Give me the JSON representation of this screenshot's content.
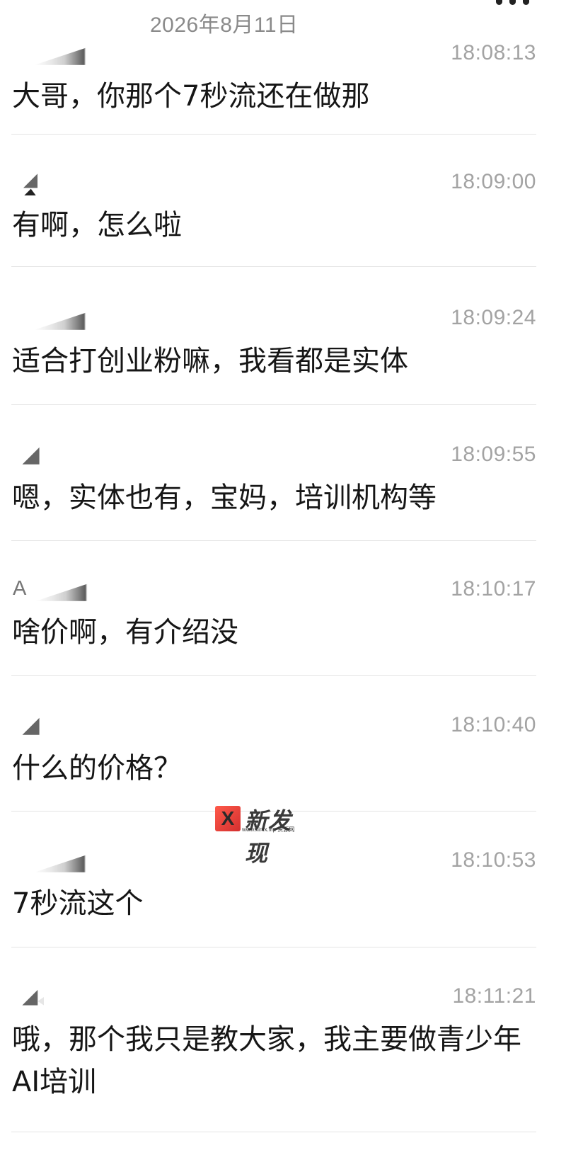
{
  "header": {
    "date": "2026年8月11日"
  },
  "messages": [
    {
      "sender_text": "",
      "time": "18:08:13",
      "text": "大哥，你那个7秒流还在做那"
    },
    {
      "sender_text": "",
      "time": "18:09:00",
      "text": "有啊，怎么啦"
    },
    {
      "sender_text": "",
      "time": "18:09:24",
      "text": "适合打创业粉嘛，我看都是实体"
    },
    {
      "sender_text": "",
      "time": "18:09:55",
      "text": "嗯，实体也有，宝妈，培训机构等"
    },
    {
      "sender_text": "A",
      "time": "18:10:17",
      "text": "啥价啊，有介绍没"
    },
    {
      "sender_text": "",
      "time": "18:10:40",
      "text": "什么的价格？"
    },
    {
      "sender_text": "",
      "time": "18:10:53",
      "text": "7秒流这个"
    },
    {
      "sender_text": "",
      "time": "18:11:21",
      "text": "哦，那个我只是教大家，我主要做青少年AI培训"
    }
  ],
  "watermark": {
    "logo_letter": "X",
    "title": "新发现",
    "subtitle": "www.xinfx.vip 资源网"
  },
  "icons": {
    "more": "more-icon",
    "redacted_avatar": "redacted-avatar-icon"
  },
  "colors": {
    "text": "#161616",
    "timestamp": "#a3a3a3",
    "date": "#8a8a8a",
    "divider": "#e4e4e4",
    "watermark_accent": "#d32f2f"
  }
}
